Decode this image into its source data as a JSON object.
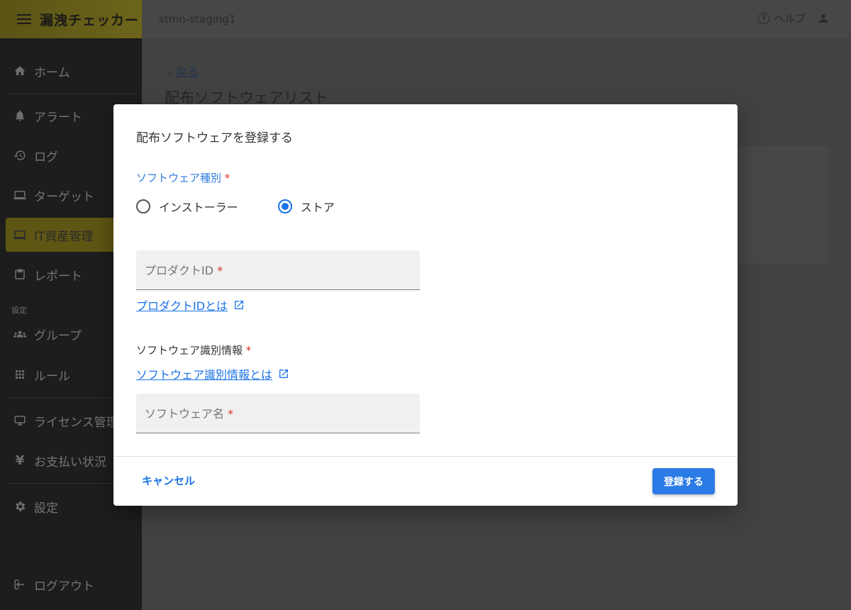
{
  "app": {
    "title": "漏洩チェッカー",
    "environment": "stmn-staging1"
  },
  "header": {
    "help_label": "ヘルプ"
  },
  "sidebar": {
    "items": [
      {
        "label": "ホーム",
        "icon": "home-icon"
      },
      {
        "label": "アラート",
        "icon": "bell-icon"
      },
      {
        "label": "ログ",
        "icon": "history-icon"
      },
      {
        "label": "ターゲット",
        "icon": "computer-icon"
      },
      {
        "label": "IT資産管理",
        "icon": "laptop-icon",
        "active": true
      },
      {
        "label": "レポート",
        "icon": "clipboard-icon"
      },
      {
        "label": "グループ",
        "icon": "group-icon"
      },
      {
        "label": "ルール",
        "icon": "grid-icon"
      },
      {
        "label": "ライセンス管理",
        "icon": "license-icon"
      },
      {
        "label": "お支払い状況",
        "icon": "yen-icon"
      },
      {
        "label": "設定",
        "icon": "gear-icon"
      },
      {
        "label": "ログアウト",
        "icon": "logout-icon"
      }
    ],
    "settings_section_label": "設定"
  },
  "page": {
    "back_label": "戻る",
    "title": "配布ソフトウェアリスト"
  },
  "modal": {
    "title": "配布ソフトウェアを登録する",
    "software_type_label": "ソフトウェア種別",
    "required_mark": "*",
    "radio_options": [
      {
        "label": "インストーラー",
        "checked": false
      },
      {
        "label": "ストア",
        "checked": true
      }
    ],
    "product_id_placeholder": "プロダクトID",
    "product_id_link": "プロダクトIDとは",
    "identification_label": "ソフトウェア識別情報",
    "identification_link": "ソフトウェア識別情報とは",
    "software_name_placeholder": "ソフトウェア名",
    "cancel_label": "キャンセル",
    "submit_label": "登録する"
  },
  "colors": {
    "accent": "#1a73e8",
    "brand": "#f5e03a",
    "required": "#d93025"
  }
}
